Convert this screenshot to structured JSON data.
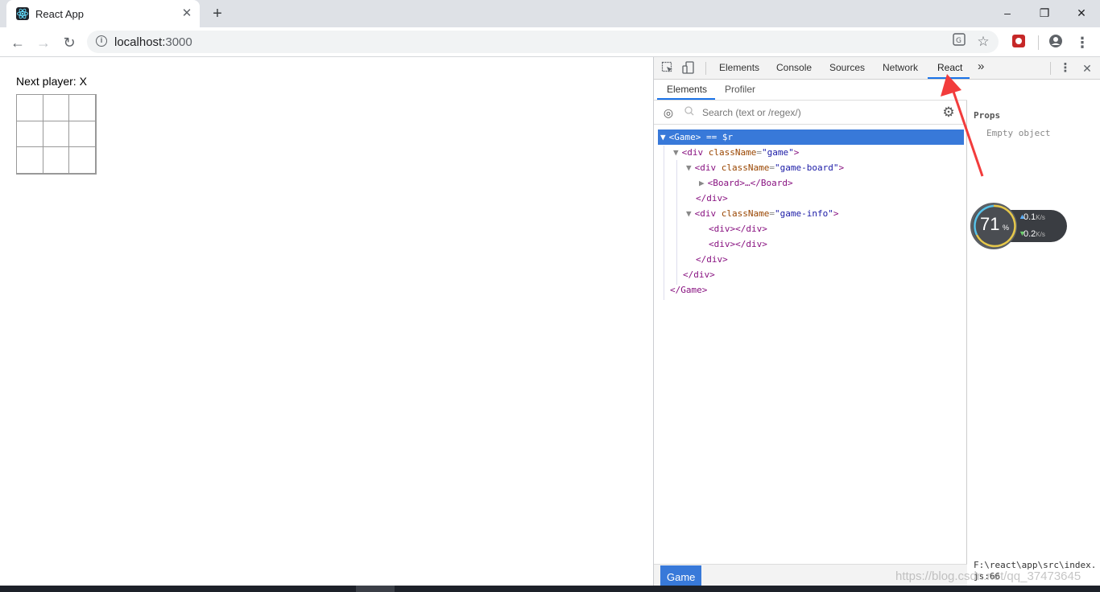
{
  "browser": {
    "tab_title": "React App",
    "tab_close": "✕",
    "new_tab": "+",
    "window_controls": [
      "–",
      "❐",
      "✕"
    ]
  },
  "toolbar": {
    "back": "←",
    "forward": "→",
    "reload": "↻",
    "url_host": "localhost:",
    "url_port": "3000"
  },
  "page": {
    "status": "Next player: X",
    "squares": [
      "",
      "",
      "",
      "",
      "",
      "",
      "",
      "",
      ""
    ]
  },
  "devtools": {
    "tabs": [
      "Elements",
      "Console",
      "Sources",
      "Network",
      "React"
    ],
    "active_tab": "React",
    "more_tabs": "»",
    "react": {
      "subtabs": [
        "Elements",
        "Profiler"
      ],
      "search_placeholder": "Search (text or /regex/)",
      "tree": [
        {
          "indent": 0,
          "toggle": "▼",
          "open": "<Game>",
          "suffix": " == $r",
          "selected": true
        },
        {
          "indent": 1,
          "toggle": "▼",
          "tag": "div",
          "attr": "className",
          "val": "\"game\""
        },
        {
          "indent": 2,
          "toggle": "▼",
          "tag": "div",
          "attr": "className",
          "val": "\"game-board\""
        },
        {
          "indent": 3,
          "toggle": "▶",
          "collapsed": "<Board>…</Board>"
        },
        {
          "indent": 2,
          "close": "</div>"
        },
        {
          "indent": 2,
          "toggle": "▼",
          "tag": "div",
          "attr": "className",
          "val": "\"game-info\""
        },
        {
          "indent": 3,
          "leaf": "<div></div>"
        },
        {
          "indent": 3,
          "leaf": "<div></div>"
        },
        {
          "indent": 2,
          "close": "</div>"
        },
        {
          "indent": 1,
          "close": "</div>"
        },
        {
          "indent": 0,
          "close": "</Game>"
        }
      ],
      "breadcrumb": "Game",
      "props_title": "Props",
      "props_empty": "Empty object",
      "file_path": "F:\\react\\app\\src\\index.js:66"
    }
  },
  "net_widget": {
    "percent": "71",
    "percent_symbol": "%",
    "up": "0.1",
    "down": "0.2",
    "unit": "K/s"
  },
  "watermark": "https://blog.csdn.net/qq_37473645",
  "annotation": {
    "arrow_color": "#f23c3c"
  }
}
